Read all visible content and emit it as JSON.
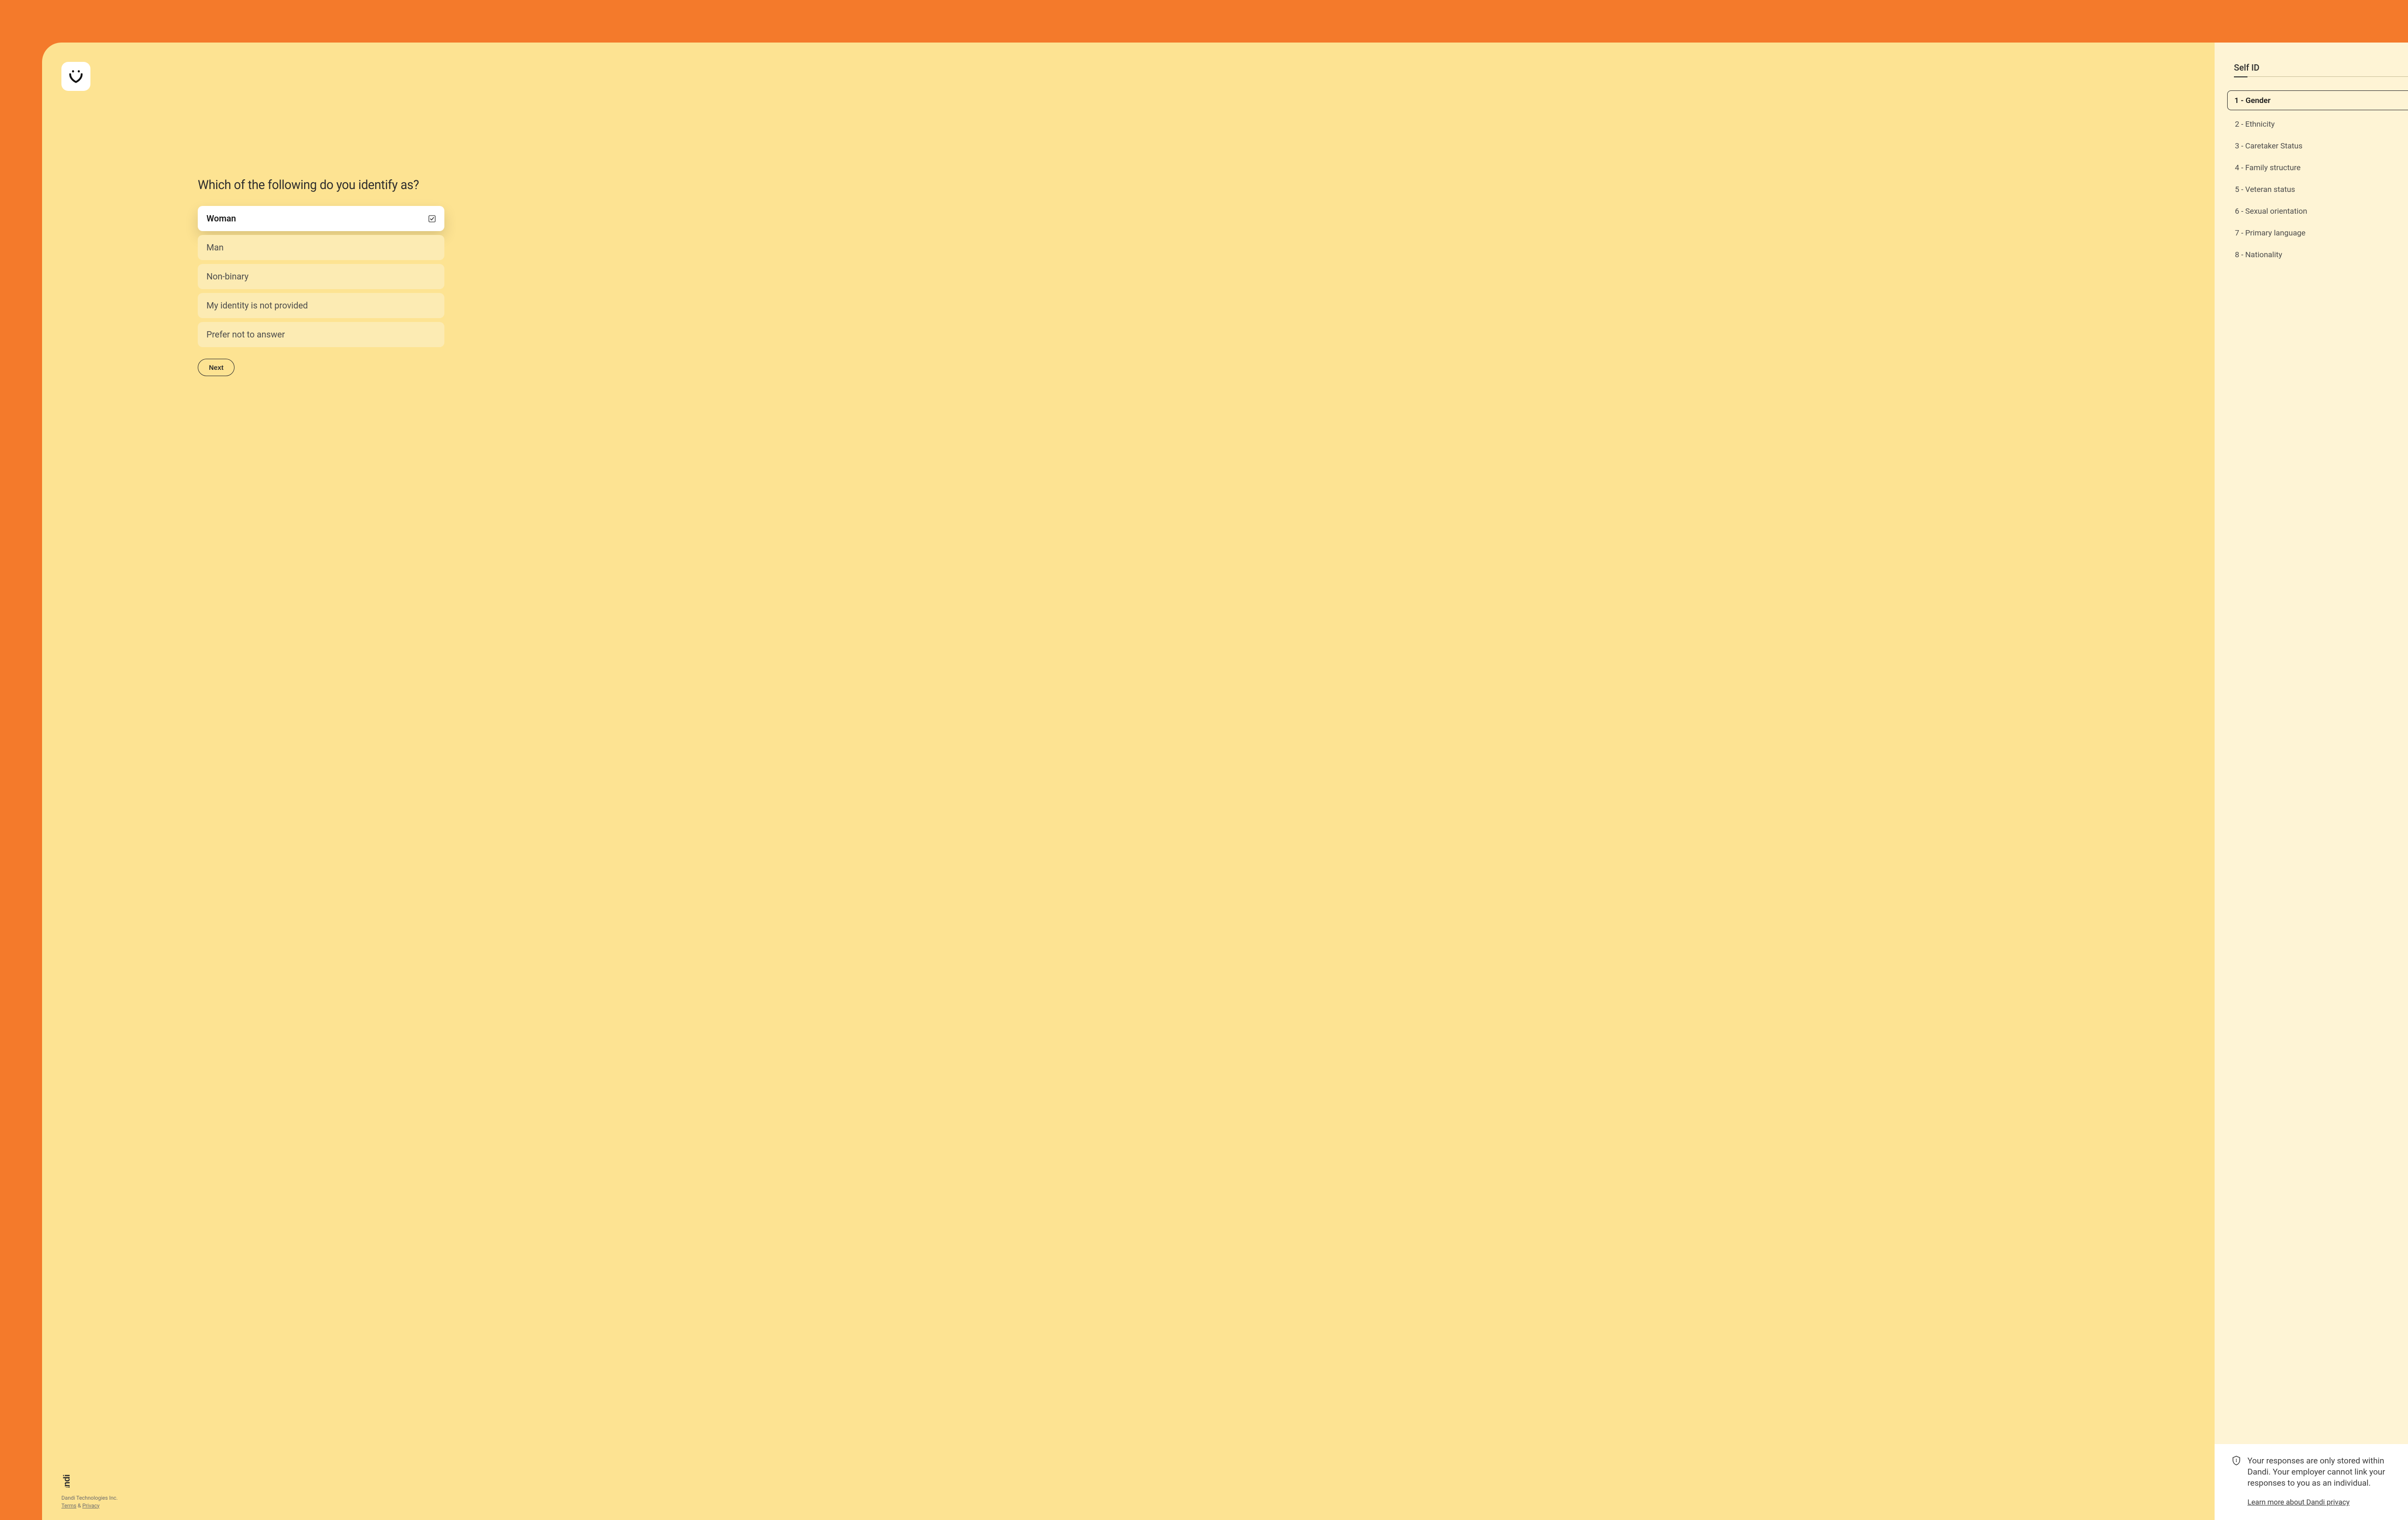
{
  "question": {
    "title": "Which of the following do you identify as?",
    "options": [
      {
        "label": "Woman",
        "selected": true
      },
      {
        "label": "Man",
        "selected": false
      },
      {
        "label": "Non-binary",
        "selected": false
      },
      {
        "label": "My identity is not provided",
        "selected": false
      },
      {
        "label": "Prefer not to answer",
        "selected": false
      }
    ],
    "next_label": "Next"
  },
  "sidebar": {
    "title": "Self ID",
    "items": [
      {
        "label": "1 - Gender",
        "active": true
      },
      {
        "label": "2 - Ethnicity",
        "active": false
      },
      {
        "label": "3 - Caretaker Status",
        "active": false
      },
      {
        "label": "4 - Family structure",
        "active": false
      },
      {
        "label": "5 - Veteran status",
        "active": false
      },
      {
        "label": "6 - Sexual orientation",
        "active": false
      },
      {
        "label": "7 - Primary language",
        "active": false
      },
      {
        "label": "8 - Nationality",
        "active": false
      }
    ]
  },
  "privacy": {
    "text": "Your responses are only stored within Dandi. Your employer cannot link your responses to you as an individual.",
    "link_label": "Learn more about Dandi privacy"
  },
  "footer": {
    "company": "Dandi Technologies Inc.",
    "terms": "Terms",
    "amp": "&",
    "privacy": "Privacy"
  }
}
